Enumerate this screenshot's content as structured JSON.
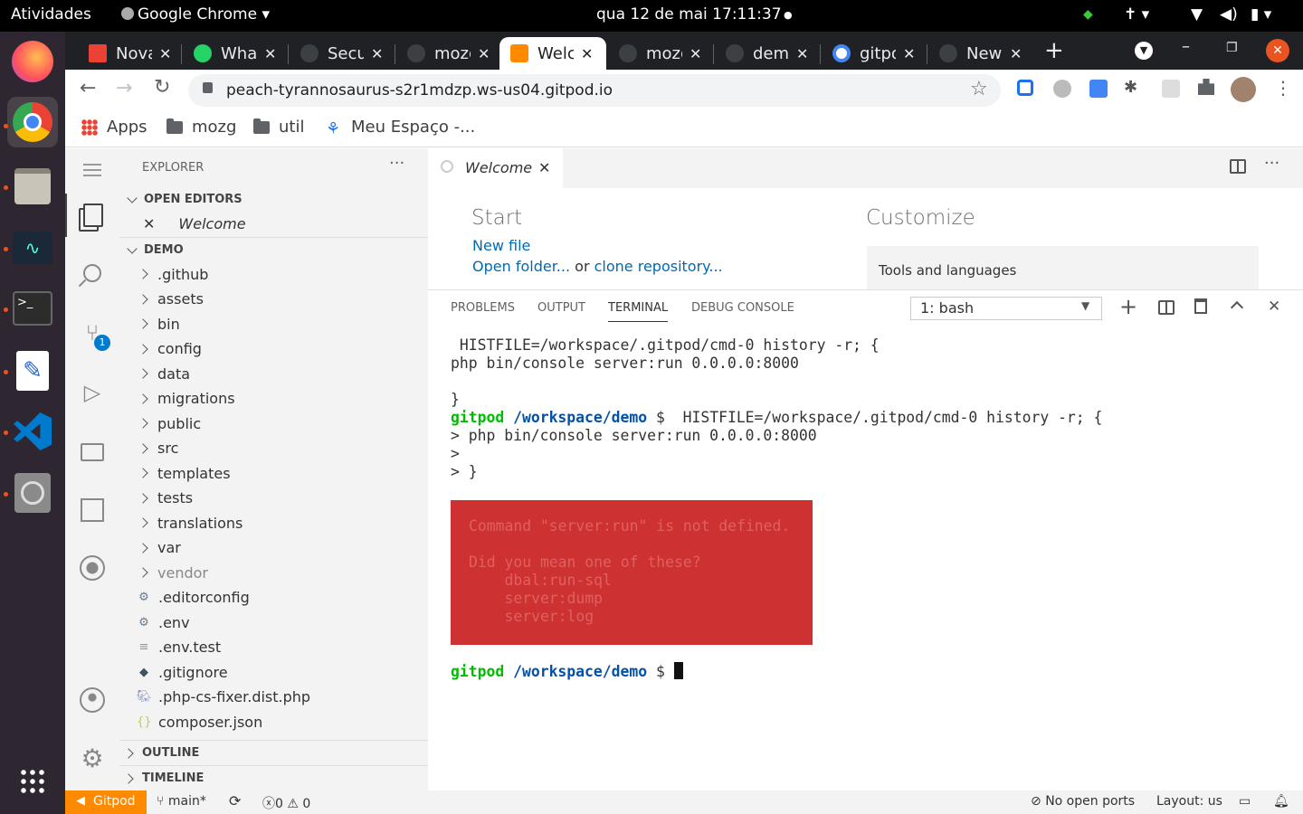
{
  "os": {
    "activities": "Atividades",
    "app": "Google Chrome",
    "clock": "qua 12 de mai  17:11:37"
  },
  "tabs": [
    {
      "title": "Nova",
      "color": "#ea4335"
    },
    {
      "title": "WhatsApp",
      "color": "#25d366"
    },
    {
      "title": "Security",
      "color": "#3c4043"
    },
    {
      "title": "mozg",
      "color": "#3c4043"
    },
    {
      "title": "Welcome",
      "color": "#ff8a00"
    },
    {
      "title": "mozg",
      "color": "#3c4043"
    },
    {
      "title": "demo",
      "color": "#3c4043"
    },
    {
      "title": "gitpod",
      "color": "#4285f4"
    },
    {
      "title": "New Tab",
      "color": "#3c4043"
    }
  ],
  "url": "peach-tyrannosaurus-s2r1mdzp.ws-us04.gitpod.io",
  "bookmarks": {
    "apps": "Apps",
    "b1": "mozg",
    "b2": "util",
    "b3": "Meu Espaço -..."
  },
  "explorer": {
    "title": "EXPLORER",
    "open_editors": "OPEN EDITORS",
    "open_file": "Welcome",
    "root": "DEMO",
    "folders": [
      ".github",
      "assets",
      "bin",
      "config",
      "data",
      "migrations",
      "public",
      "src",
      "templates",
      "tests",
      "translations",
      "var",
      "vendor"
    ],
    "files": [
      ".editorconfig",
      ".env",
      ".env.test",
      ".gitignore",
      ".php-cs-fixer.dist.php",
      "composer.json"
    ],
    "outline": "OUTLINE",
    "timeline": "TIMELINE"
  },
  "scm_badge": "1",
  "editor": {
    "tab": "Welcome",
    "start": "Start",
    "new_file": "New file",
    "open_folder": "Open folder...",
    "or": "or",
    "clone": "clone repository...",
    "customize": "Customize",
    "tools": "Tools and languages"
  },
  "panel": {
    "problems": "PROBLEMS",
    "output": "OUTPUT",
    "terminal": "TERMINAL",
    "debug": "DEBUG CONSOLE",
    "shell": "1: bash"
  },
  "terminal": {
    "l1": " HISTFILE=/workspace/.gitpod/cmd-0 history -r; {",
    "l2": "php bin/console server:run 0.0.0.0:8000",
    "l3": "}",
    "prompt_user": "gitpod",
    "prompt_path": "/workspace/demo",
    "prompt_sym": "$",
    "l4_cmd": "  HISTFILE=/workspace/.gitpod/cmd-0 history -r; {",
    "l5": "> php bin/console server:run 0.0.0.0:8000",
    "l6": ">",
    "l7": "> }",
    "err1": "Command \"server:run\" is not defined.",
    "err2": "Did you mean one of these?",
    "err3": "    dbal:run-sql",
    "err4": "    server:dump",
    "err5": "    server:log"
  },
  "status": {
    "gitpod": "Gitpod",
    "branch": "main*",
    "errors": "0",
    "warnings": "0",
    "ports": "No open ports",
    "layout": "Layout: us"
  },
  "colors": {
    "gitpod_orange": "#ff8a00",
    "error_bg": "#cd3131",
    "prompt_green": "#00bc00",
    "prompt_blue": "#0451a5",
    "link": "#006ab1"
  }
}
